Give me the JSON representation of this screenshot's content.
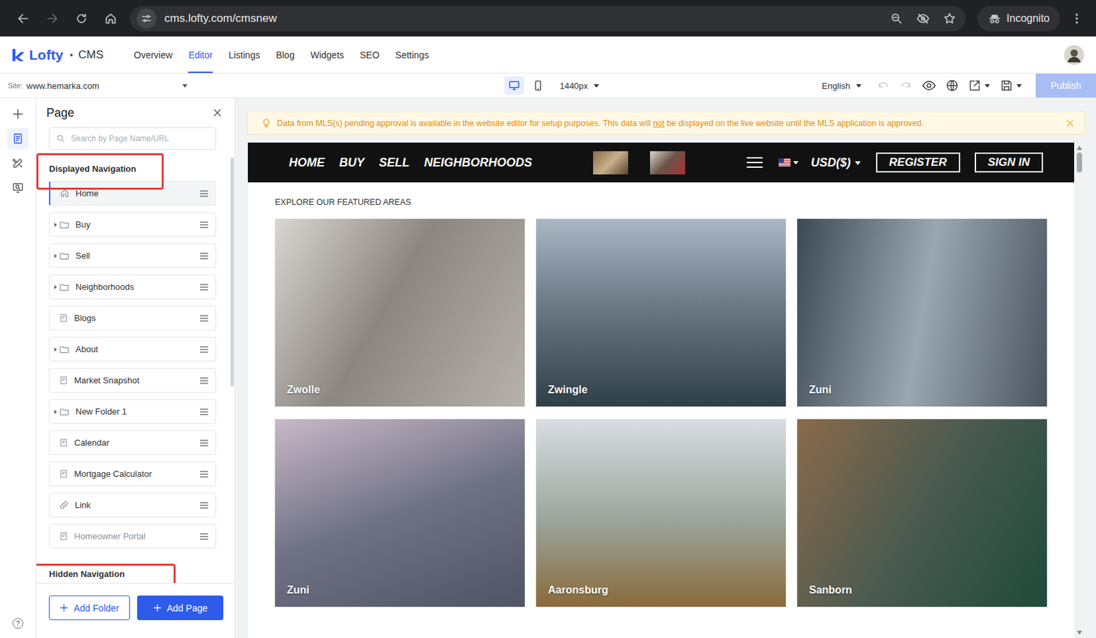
{
  "browser": {
    "url": "cms.lofty.com/cmsnew",
    "profile": "Incognito",
    "forward_disabled": true
  },
  "app": {
    "logo": "Lofty",
    "separator": "•",
    "product": "CMS",
    "nav": [
      {
        "label": "Overview",
        "selected": false
      },
      {
        "label": "Editor",
        "selected": true
      },
      {
        "label": "Listings",
        "selected": false
      },
      {
        "label": "Blog",
        "selected": false
      },
      {
        "label": "Widgets",
        "selected": false
      },
      {
        "label": "SEO",
        "selected": false
      },
      {
        "label": "Settings",
        "selected": false
      }
    ]
  },
  "toolbar": {
    "site_label": "Site:",
    "site": "www.hemarka.com",
    "devices": [
      {
        "kind": "desktop",
        "selected": true
      },
      {
        "kind": "mobile",
        "selected": false
      }
    ],
    "width": "1440px",
    "language": "English",
    "undo_disabled": true,
    "redo_disabled": true,
    "publish": "Publish",
    "publish_disabled": true
  },
  "rail": {
    "items": [
      {
        "kind": "add",
        "selected": false
      },
      {
        "kind": "pages",
        "selected": true
      },
      {
        "kind": "design",
        "selected": false
      },
      {
        "kind": "preview",
        "selected": false
      }
    ],
    "help": "?"
  },
  "panel": {
    "title": "Page",
    "search_placeholder": "Search by Page Name/URL",
    "sections": [
      {
        "title": "Displayed Navigation",
        "highlighted": true,
        "items": [
          {
            "label": "Home",
            "kind": "home",
            "expanded": false,
            "selected": true,
            "disabled": false
          },
          {
            "label": "Buy",
            "kind": "folder",
            "expanded": false,
            "selected": false,
            "disabled": false
          },
          {
            "label": "Sell",
            "kind": "folder",
            "expanded": false,
            "selected": false,
            "disabled": false
          },
          {
            "label": "Neighborhoods",
            "kind": "folder",
            "expanded": false,
            "selected": false,
            "disabled": false
          },
          {
            "label": "Blogs",
            "kind": "page",
            "expanded": false,
            "selected": false,
            "disabled": false
          },
          {
            "label": "About",
            "kind": "folder",
            "expanded": false,
            "selected": false,
            "disabled": false
          },
          {
            "label": "Market Snapshot",
            "kind": "page",
            "expanded": false,
            "selected": false,
            "disabled": false
          },
          {
            "label": "New Folder 1",
            "kind": "folder",
            "expanded": false,
            "selected": false,
            "disabled": false
          },
          {
            "label": "Calendar",
            "kind": "page",
            "expanded": false,
            "selected": false,
            "disabled": false
          },
          {
            "label": "Mortgage Calculator",
            "kind": "page",
            "expanded": false,
            "selected": false,
            "disabled": false
          },
          {
            "label": "Link",
            "kind": "link",
            "expanded": false,
            "selected": false,
            "disabled": false
          },
          {
            "label": "Homeowner Portal",
            "kind": "page",
            "expanded": false,
            "selected": false,
            "disabled": true
          }
        ]
      },
      {
        "title": "Hidden Navigation",
        "highlighted": true,
        "items": []
      }
    ],
    "buttons": [
      {
        "label": "Add Folder",
        "kind": "outline"
      },
      {
        "label": "Add Page",
        "kind": "primary"
      }
    ]
  },
  "notice": {
    "before": "Data from MLS(s) pending approval is available in the website editor for setup purposes. This data will ",
    "emphasis": "not",
    "after": " be displayed on the live website until the MLS application is approved."
  },
  "preview": {
    "nav": [
      "HOME",
      "BUY",
      "SELL",
      "NEIGHBORHOODS"
    ],
    "currency": "USD($)",
    "buttons": [
      "REGISTER",
      "SIGN IN"
    ],
    "section_title": "EXPLORE OUR FEATURED AREAS",
    "areas": [
      {
        "name": "Zwolle"
      },
      {
        "name": "Zwingle"
      },
      {
        "name": "Zuni"
      },
      {
        "name": "Zuni"
      },
      {
        "name": "Aaronsburg"
      },
      {
        "name": "Sanborn"
      }
    ]
  }
}
